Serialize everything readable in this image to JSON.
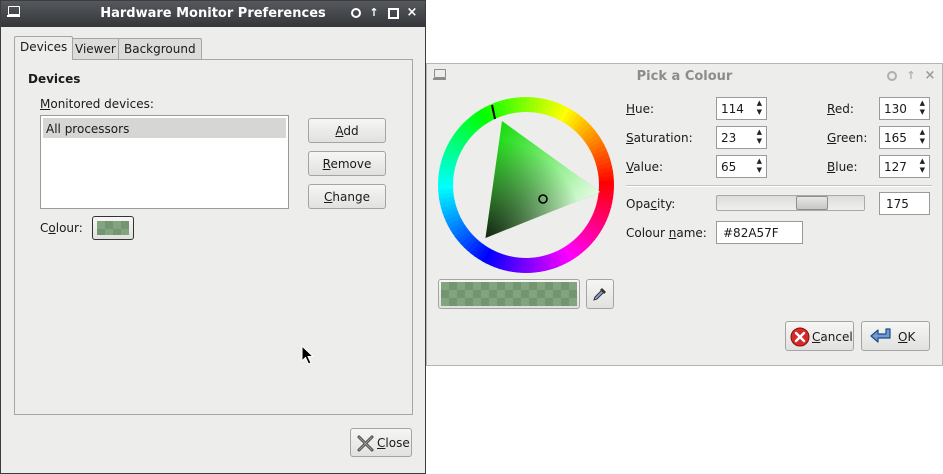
{
  "prefs_window": {
    "title": "Hardware Monitor Preferences",
    "tabs": [
      {
        "label": "Devices"
      },
      {
        "label": "Viewer"
      },
      {
        "label": "Background"
      }
    ],
    "section_title": "Devices",
    "monitored_label": "Monitored devices:",
    "devices": [
      "All processors"
    ],
    "buttons": {
      "add": "Add",
      "remove": "Remove",
      "change": "Change"
    },
    "colour_label": "Colour:",
    "close_label": "Close",
    "selected_colour": "#82a57f"
  },
  "picker_window": {
    "title": "Pick a Colour",
    "hue_label": "Hue:",
    "hue": "114",
    "saturation_label": "Saturation:",
    "saturation": "23",
    "value_label": "Value:",
    "value": "65",
    "red_label": "Red:",
    "red": "130",
    "green_label": "Green:",
    "green": "165",
    "blue_label": "Blue:",
    "blue": "127",
    "opacity_label": "Opacity:",
    "opacity": "175",
    "opacity_fraction": 0.686,
    "colour_name_label": "Colour name:",
    "colour_name": "#82A57F",
    "cancel_label": "Cancel",
    "ok_label": "OK"
  },
  "icons": {
    "window_icon": "monitor-icon",
    "close_button_icon": "close-x-icon",
    "eyedropper": "eyedropper-icon",
    "cancel_icon": "red-cancel-icon",
    "ok_icon": "blue-return-arrow-icon"
  }
}
